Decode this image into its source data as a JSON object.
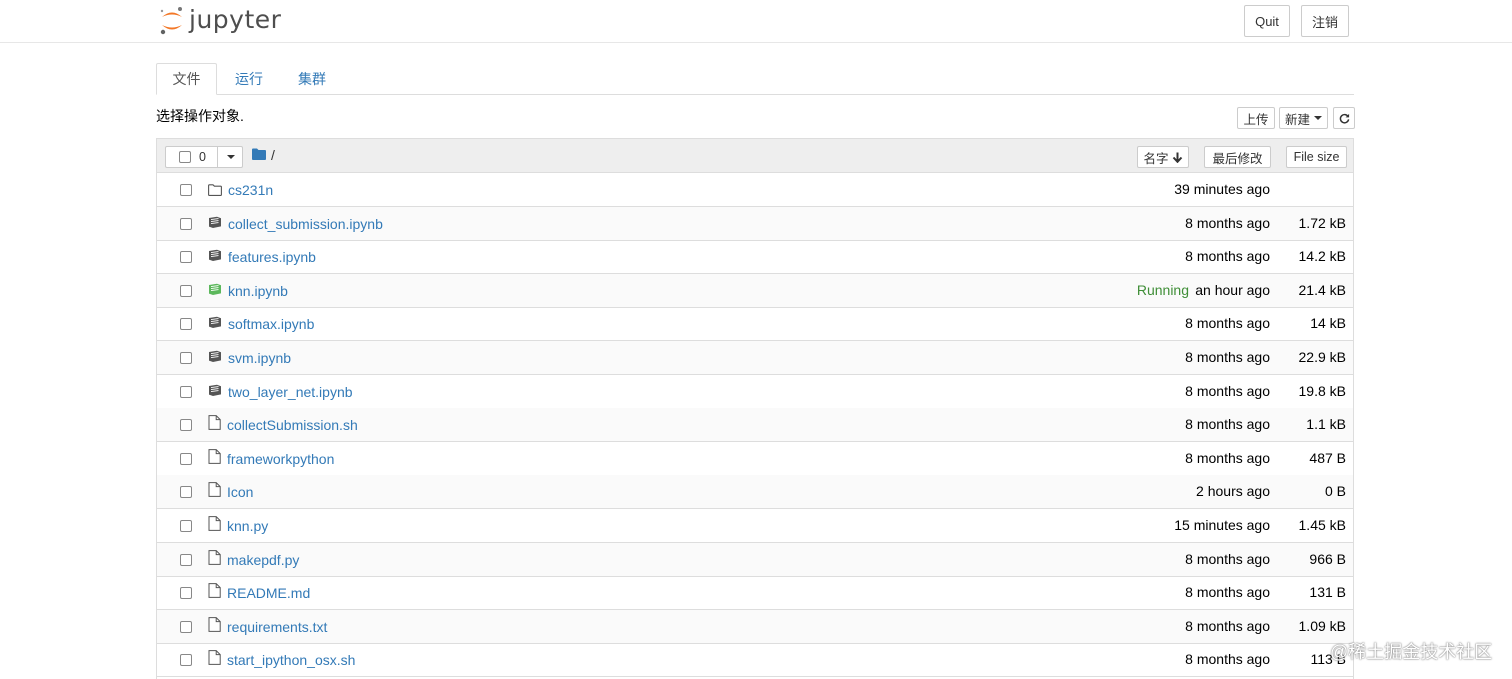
{
  "header": {
    "logo_text": "jupyter",
    "quit_label": "Quit",
    "logout_label": "注销"
  },
  "tabs": [
    {
      "label": "文件",
      "active": true
    },
    {
      "label": "运行",
      "active": false
    },
    {
      "label": "集群",
      "active": false
    }
  ],
  "toolbar": {
    "instruction": "选择操作对象.",
    "upload_label": "上传",
    "new_label": "新建",
    "refresh_icon": "refresh-icon"
  },
  "list_header": {
    "selected_count": "0",
    "path": "/",
    "sort_name_label": "名字",
    "last_modified_label": "最后修改",
    "file_size_label": "File size"
  },
  "files": [
    {
      "name": "cs231n",
      "type": "folder",
      "modified": "39 minutes ago",
      "size": "",
      "status": ""
    },
    {
      "name": "collect_submission.ipynb",
      "type": "notebook",
      "modified": "8 months ago",
      "size": "1.72 kB",
      "status": ""
    },
    {
      "name": "features.ipynb",
      "type": "notebook",
      "modified": "8 months ago",
      "size": "14.2 kB",
      "status": ""
    },
    {
      "name": "knn.ipynb",
      "type": "notebook-running",
      "modified": "an hour ago",
      "size": "21.4 kB",
      "status": "Running"
    },
    {
      "name": "softmax.ipynb",
      "type": "notebook",
      "modified": "8 months ago",
      "size": "14 kB",
      "status": ""
    },
    {
      "name": "svm.ipynb",
      "type": "notebook",
      "modified": "8 months ago",
      "size": "22.9 kB",
      "status": ""
    },
    {
      "name": "two_layer_net.ipynb",
      "type": "notebook",
      "modified": "8 months ago",
      "size": "19.8 kB",
      "status": ""
    },
    {
      "name": "collectSubmission.sh",
      "type": "file",
      "modified": "8 months ago",
      "size": "1.1 kB",
      "status": ""
    },
    {
      "name": "frameworkpython",
      "type": "file",
      "modified": "8 months ago",
      "size": "487 B",
      "status": ""
    },
    {
      "name": "Icon",
      "type": "file",
      "modified": "2 hours ago",
      "size": "0 B",
      "status": ""
    },
    {
      "name": "knn.py",
      "type": "file",
      "modified": "15 minutes ago",
      "size": "1.45 kB",
      "status": ""
    },
    {
      "name": "makepdf.py",
      "type": "file",
      "modified": "8 months ago",
      "size": "966 B",
      "status": ""
    },
    {
      "name": "README.md",
      "type": "file",
      "modified": "8 months ago",
      "size": "131 B",
      "status": ""
    },
    {
      "name": "requirements.txt",
      "type": "file",
      "modified": "8 months ago",
      "size": "1.09 kB",
      "status": ""
    },
    {
      "name": "start_ipython_osx.sh",
      "type": "file",
      "modified": "8 months ago",
      "size": "113 B",
      "status": ""
    }
  ],
  "watermark": "@稀土掘金技术社区",
  "colors": {
    "link": "#337ab7",
    "running": "#3f8e37",
    "logo_orange": "#f37726",
    "border": "#dddddd"
  }
}
